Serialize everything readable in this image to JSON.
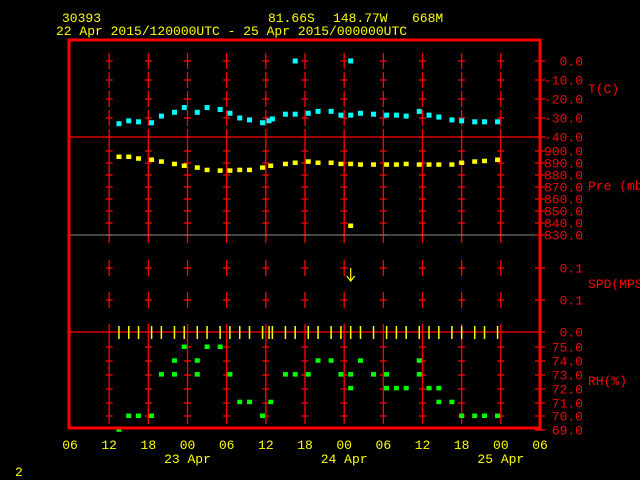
{
  "header": {
    "station": "30393",
    "lat": "81.66S",
    "lon": "148.77W",
    "elev": "668M",
    "period": "22 Apr 2015/120000UTC - 25 Apr 2015/000000UTC"
  },
  "footer": {
    "page": "2"
  },
  "colors": {
    "frame": "#ff0000",
    "temperature": "#00ffff",
    "pressure": "#ffff00",
    "wind": "#ffff00",
    "rh": "#00ff00",
    "text": "#ffff00",
    "axis_text": "#ff0000"
  },
  "chart_data": {
    "type": "scatter",
    "x_axis": {
      "range": [
        "22 Apr 06 UTC",
        "25 Apr 06 UTC"
      ],
      "tick_labels": [
        "06",
        "12",
        "18",
        "00",
        "06",
        "12",
        "18",
        "00",
        "06",
        "12",
        "18",
        "00",
        "06"
      ],
      "date_labels": [
        "23 Apr",
        "24 Apr",
        "25 Apr"
      ]
    },
    "panels": [
      {
        "name": "T(C)",
        "ticks": [
          "0.0",
          "-10.0",
          "-20.0",
          "-30.0",
          "-40.0"
        ],
        "ylim": [
          -40,
          0
        ],
        "points": [
          [
            "22 13:30",
            -33
          ],
          [
            "22 15:00",
            -31.5
          ],
          [
            "22 16:30",
            -32
          ],
          [
            "22 18:30",
            -32.5
          ],
          [
            "22 20:00",
            -29
          ],
          [
            "22 22:00",
            -27
          ],
          [
            "22 23:30",
            -24.5
          ],
          [
            "23 01:30",
            -27
          ],
          [
            "23 03:00",
            -24.5
          ],
          [
            "23 05:00",
            -25.5
          ],
          [
            "23 06:30",
            -27.5
          ],
          [
            "23 08:00",
            -30
          ],
          [
            "23 09:30",
            -31
          ],
          [
            "23 11:30",
            -32.5
          ],
          [
            "23 12:30",
            -31.5
          ],
          [
            "23 13:00",
            -30.5
          ],
          [
            "23 15:00",
            -28
          ],
          [
            "23 16:30",
            -28
          ],
          [
            "23 16:30",
            0
          ],
          [
            "23 18:30",
            -27.5
          ],
          [
            "23 20:00",
            -26.5
          ],
          [
            "23 22:00",
            -26.5
          ],
          [
            "23 23:30",
            -28.5
          ],
          [
            "24 01:00",
            -28.5
          ],
          [
            "24 01:00",
            0
          ],
          [
            "24 02:30",
            -27.5
          ],
          [
            "24 04:30",
            -28
          ],
          [
            "24 06:30",
            -28.5
          ],
          [
            "24 08:00",
            -28.5
          ],
          [
            "24 09:30",
            -29
          ],
          [
            "24 11:30",
            -26.5
          ],
          [
            "24 13:00",
            -28.5
          ],
          [
            "24 14:30",
            -29.5
          ],
          [
            "24 16:30",
            -31
          ],
          [
            "24 18:00",
            -31.5
          ],
          [
            "24 20:00",
            -32
          ],
          [
            "24 21:30",
            -32
          ],
          [
            "24 23:30",
            -32
          ]
        ]
      },
      {
        "name": "Pre (mb)",
        "ticks": [
          "900.0",
          "890.0",
          "880.0",
          "870.0",
          "860.0",
          "850.0",
          "840.0",
          "830.0"
        ],
        "ylim": [
          830,
          900
        ],
        "points": [
          [
            "22 13:30",
            895
          ],
          [
            "22 15:00",
            895
          ],
          [
            "22 16:30",
            893.5
          ],
          [
            "22 18:30",
            892.5
          ],
          [
            "22 20:00",
            891
          ],
          [
            "22 22:00",
            889
          ],
          [
            "22 23:30",
            887.5
          ],
          [
            "23 01:30",
            886
          ],
          [
            "23 03:00",
            884
          ],
          [
            "23 05:00",
            883.5
          ],
          [
            "23 06:30",
            883.5
          ],
          [
            "23 08:00",
            884
          ],
          [
            "23 09:30",
            884
          ],
          [
            "23 11:30",
            886
          ],
          [
            "23 12:45",
            887.5
          ],
          [
            "23 15:00",
            889
          ],
          [
            "23 16:30",
            890
          ],
          [
            "23 18:30",
            891
          ],
          [
            "23 20:00",
            890
          ],
          [
            "23 22:00",
            890
          ],
          [
            "23 23:30",
            889
          ],
          [
            "24 01:00",
            889
          ],
          [
            "24 01:00",
            837.5
          ],
          [
            "24 02:30",
            888.5
          ],
          [
            "24 04:30",
            888.5
          ],
          [
            "24 06:30",
            888.5
          ],
          [
            "24 08:00",
            888.5
          ],
          [
            "24 09:30",
            889
          ],
          [
            "24 11:30",
            888.5
          ],
          [
            "24 13:00",
            888.5
          ],
          [
            "24 14:30",
            888.5
          ],
          [
            "24 16:30",
            888.5
          ],
          [
            "24 18:00",
            890
          ],
          [
            "24 20:00",
            891
          ],
          [
            "24 21:30",
            891.5
          ],
          [
            "24 23:30",
            892.5
          ]
        ]
      },
      {
        "name": "SPD(MPS)",
        "ticks": [
          "0.1",
          "0.1",
          "0.0"
        ],
        "ylim": [
          0,
          0.2
        ],
        "wind_direction_arrow": {
          "time": "24 01:00",
          "direction": "down"
        },
        "points": [
          [
            "22 13:30",
            0
          ],
          [
            "22 15:00",
            0
          ],
          [
            "22 16:30",
            0
          ],
          [
            "22 18:30",
            0
          ],
          [
            "22 20:00",
            0
          ],
          [
            "22 22:00",
            0
          ],
          [
            "22 23:30",
            0
          ],
          [
            "23 01:30",
            0
          ],
          [
            "23 03:00",
            0
          ],
          [
            "23 05:00",
            0
          ],
          [
            "23 06:30",
            0
          ],
          [
            "23 08:00",
            0
          ],
          [
            "23 09:30",
            0
          ],
          [
            "23 11:30",
            0
          ],
          [
            "23 12:30",
            0
          ],
          [
            "23 13:00",
            0
          ],
          [
            "23 15:00",
            0
          ],
          [
            "23 16:30",
            0
          ],
          [
            "23 18:30",
            0
          ],
          [
            "23 20:00",
            0
          ],
          [
            "23 22:00",
            0
          ],
          [
            "23 23:30",
            0
          ],
          [
            "24 01:00",
            0
          ],
          [
            "24 02:30",
            0
          ],
          [
            "24 04:30",
            0
          ],
          [
            "24 06:30",
            0
          ],
          [
            "24 08:00",
            0
          ],
          [
            "24 09:30",
            0
          ],
          [
            "24 11:30",
            0
          ],
          [
            "24 13:00",
            0
          ],
          [
            "24 14:30",
            0
          ],
          [
            "24 16:30",
            0
          ],
          [
            "24 18:00",
            0
          ],
          [
            "24 20:00",
            0
          ],
          [
            "24 21:30",
            0
          ],
          [
            "24 23:30",
            0
          ]
        ]
      },
      {
        "name": "RH(%)",
        "ticks": [
          "75.0",
          "74.0",
          "73.0",
          "72.0",
          "71.0",
          "70.0",
          "69.0"
        ],
        "ylim": [
          69,
          75
        ],
        "points": [
          [
            "22 13:30",
            69
          ],
          [
            "22 15:00",
            70
          ],
          [
            "22 16:30",
            70
          ],
          [
            "22 18:30",
            70
          ],
          [
            "22 20:00",
            73
          ],
          [
            "22 22:00",
            74
          ],
          [
            "22 22:00",
            73
          ],
          [
            "22 23:30",
            75
          ],
          [
            "23 01:30",
            74
          ],
          [
            "23 01:30",
            73
          ],
          [
            "23 03:00",
            75
          ],
          [
            "23 05:00",
            75
          ],
          [
            "23 06:30",
            73
          ],
          [
            "23 08:00",
            71
          ],
          [
            "23 09:30",
            71
          ],
          [
            "23 11:30",
            70
          ],
          [
            "23 12:45",
            71
          ],
          [
            "23 15:00",
            73
          ],
          [
            "23 16:30",
            73
          ],
          [
            "23 18:30",
            73
          ],
          [
            "23 20:00",
            74
          ],
          [
            "23 22:00",
            74
          ],
          [
            "23 23:30",
            73
          ],
          [
            "24 01:00",
            73
          ],
          [
            "24 01:00",
            72
          ],
          [
            "24 02:30",
            74
          ],
          [
            "24 04:30",
            73
          ],
          [
            "24 06:30",
            73
          ],
          [
            "24 06:30",
            72
          ],
          [
            "24 08:00",
            72
          ],
          [
            "24 09:30",
            72
          ],
          [
            "24 11:30",
            74
          ],
          [
            "24 11:30",
            73
          ],
          [
            "24 13:00",
            72
          ],
          [
            "24 14:30",
            72
          ],
          [
            "24 14:30",
            71
          ],
          [
            "24 16:30",
            71
          ],
          [
            "24 18:00",
            70
          ],
          [
            "24 20:00",
            70
          ],
          [
            "24 21:30",
            70
          ],
          [
            "24 23:30",
            70
          ]
        ]
      }
    ]
  }
}
